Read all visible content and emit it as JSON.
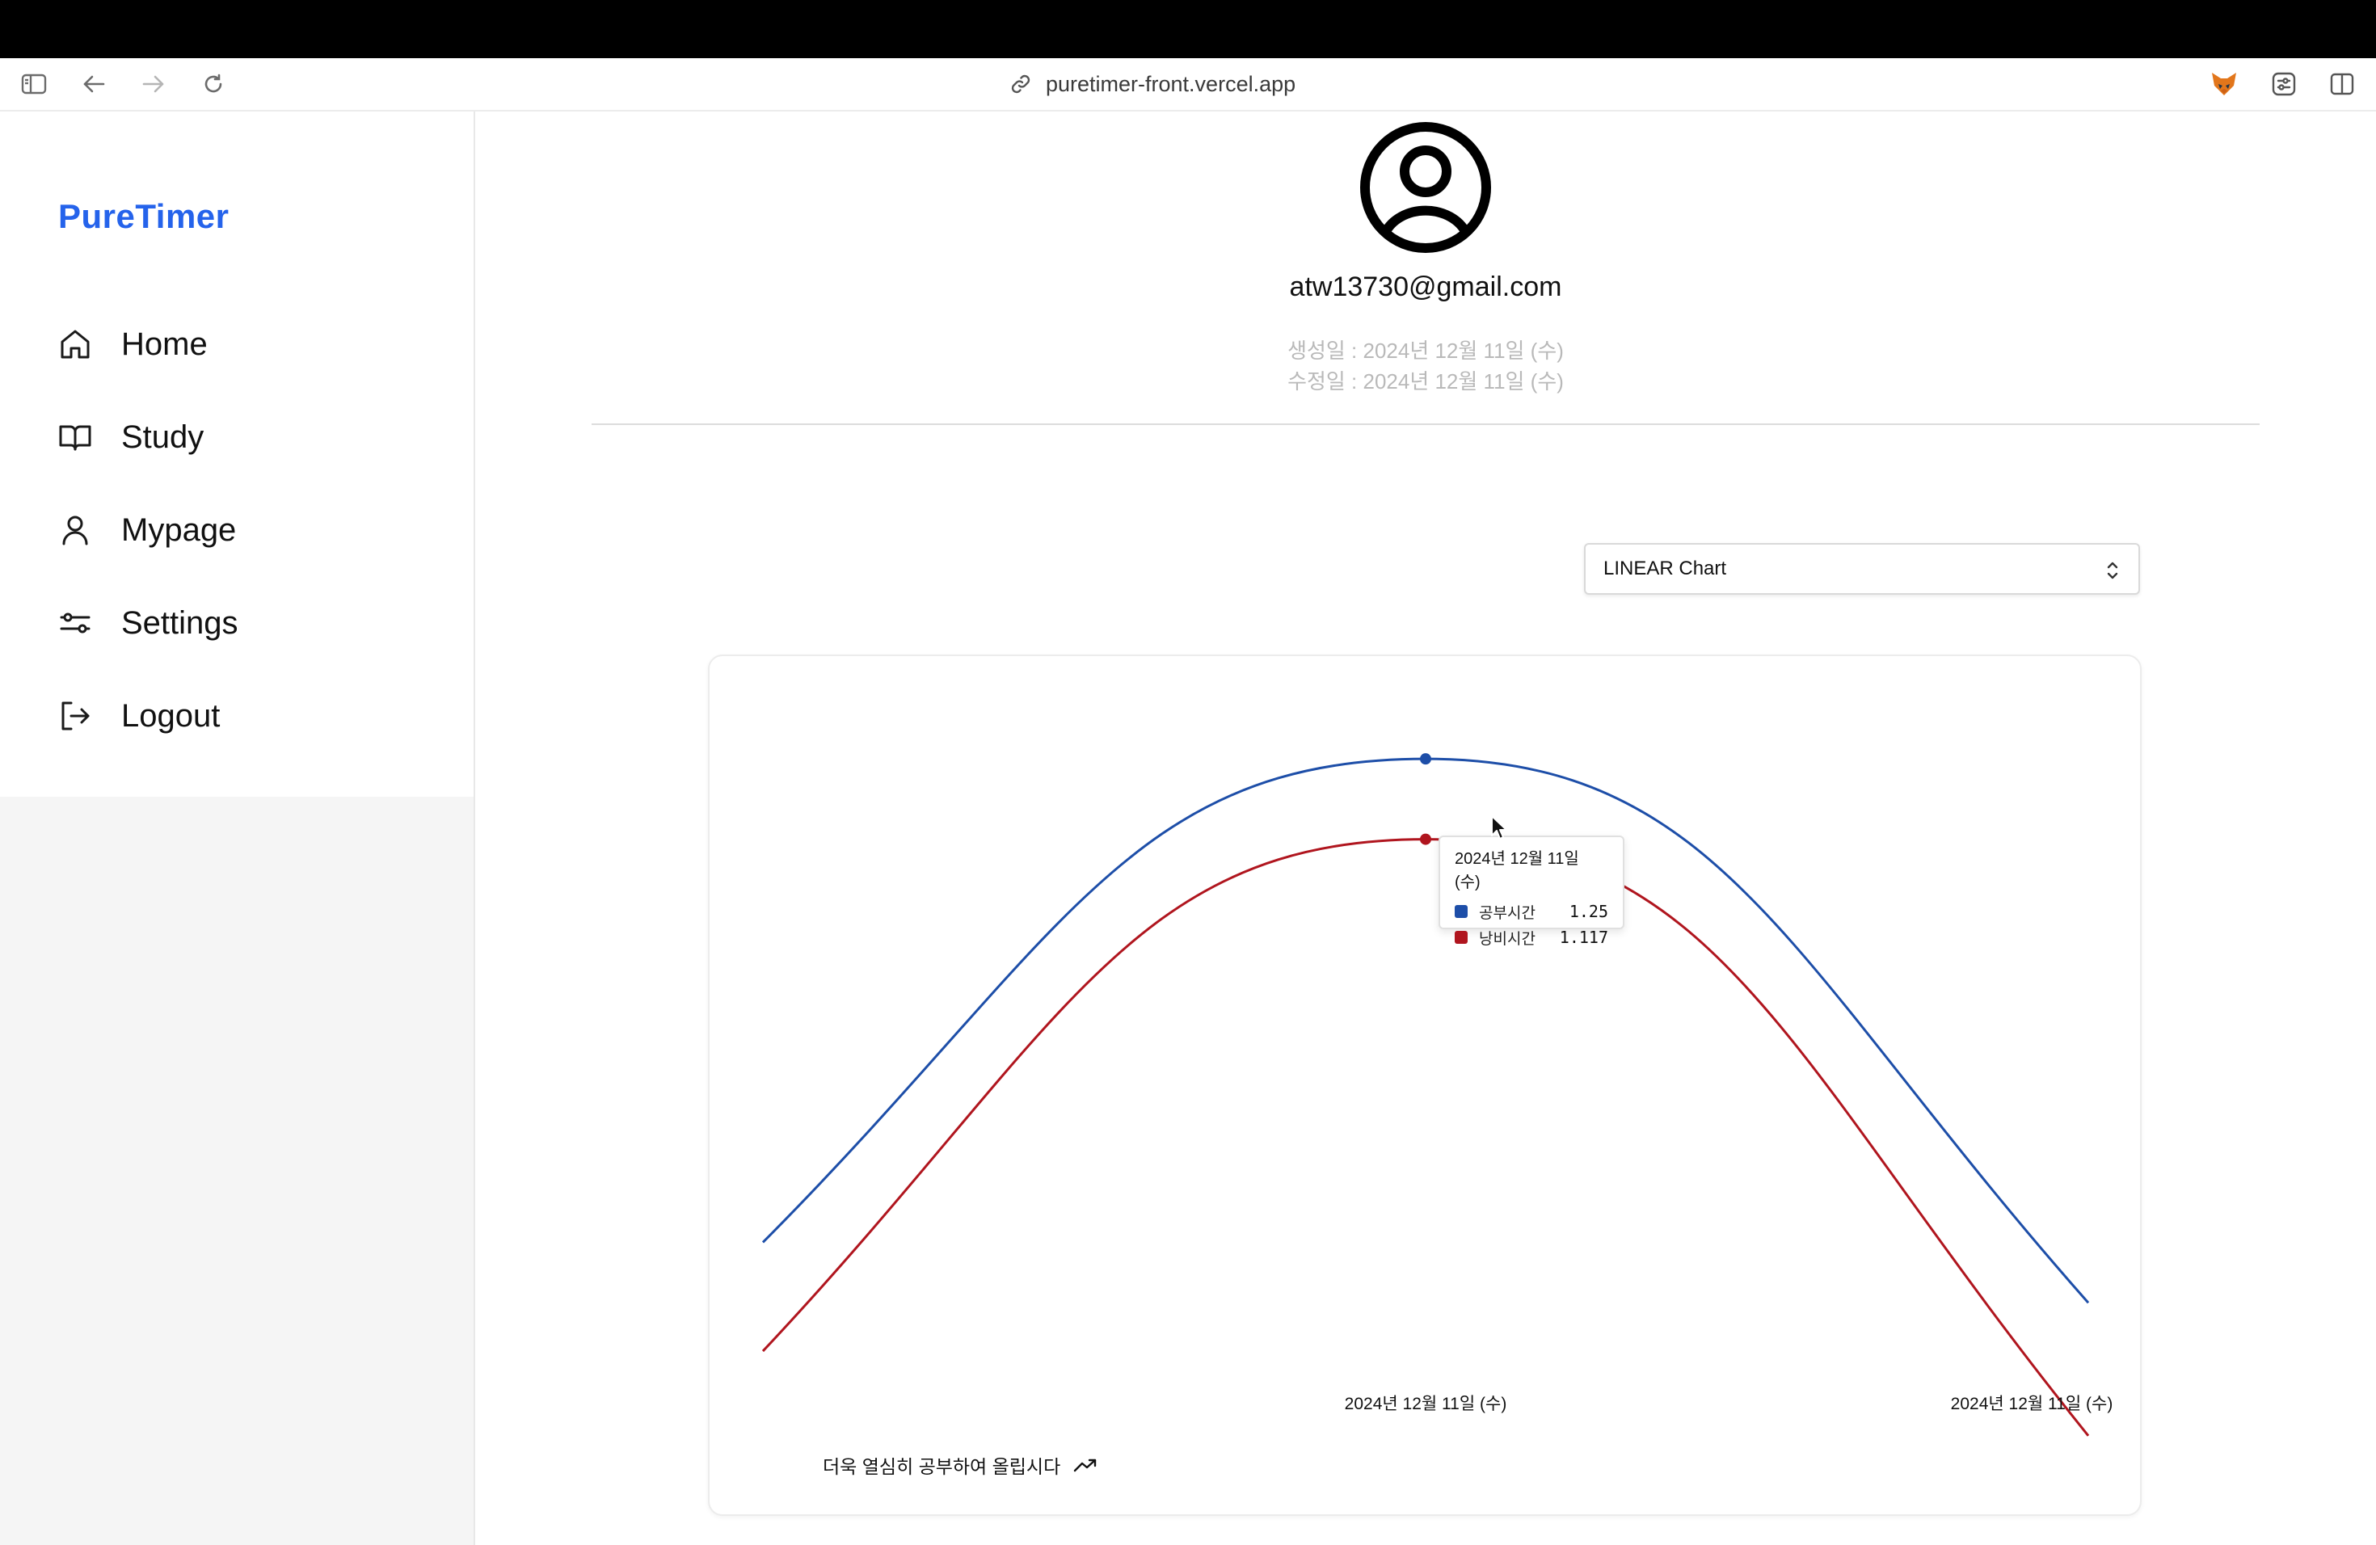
{
  "browser": {
    "url": "puretimer-front.vercel.app"
  },
  "sidebar": {
    "brand": "PureTimer",
    "brand_color": "#2563eb",
    "items": [
      {
        "label": "Home",
        "icon": "home-icon"
      },
      {
        "label": "Study",
        "icon": "book-icon"
      },
      {
        "label": "Mypage",
        "icon": "user-icon"
      },
      {
        "label": "Settings",
        "icon": "sliders-icon"
      },
      {
        "label": "Logout",
        "icon": "logout-icon"
      }
    ]
  },
  "profile": {
    "email": "atw13730@gmail.com",
    "created": "생성일 : 2024년 12월 11일 (수)",
    "updated": "수정일 : 2024년 12월 11일 (수)"
  },
  "chart_select": {
    "value": "LINEAR Chart"
  },
  "chart_data": {
    "type": "line",
    "x": [
      "",
      "2024년 12월 11일 (수)",
      "2024년 12월 11일 (수)"
    ],
    "tick_labels": [
      "2024년 12월 11일 (수)",
      "2024년 12월 11일 (수)"
    ],
    "series": [
      {
        "name": "공부시간",
        "color": "#1d4ea8",
        "values": [
          0.45,
          1.25,
          0.35
        ]
      },
      {
        "name": "낭비시간",
        "color": "#b0151e",
        "values": [
          0.27,
          1.117,
          0.13
        ]
      }
    ],
    "ylim": [
      0,
      1.42
    ],
    "grid": false,
    "legend": "tooltip"
  },
  "tooltip": {
    "title": "2024년 12월 11일 (수)",
    "rows": [
      {
        "name": "공부시간",
        "value": "1.25",
        "color": "#1d4ea8"
      },
      {
        "name": "낭비시간",
        "value": "1.117",
        "color": "#b0151e"
      }
    ]
  },
  "footer": {
    "text": "더욱 열심히 공부하여 올립시다"
  }
}
